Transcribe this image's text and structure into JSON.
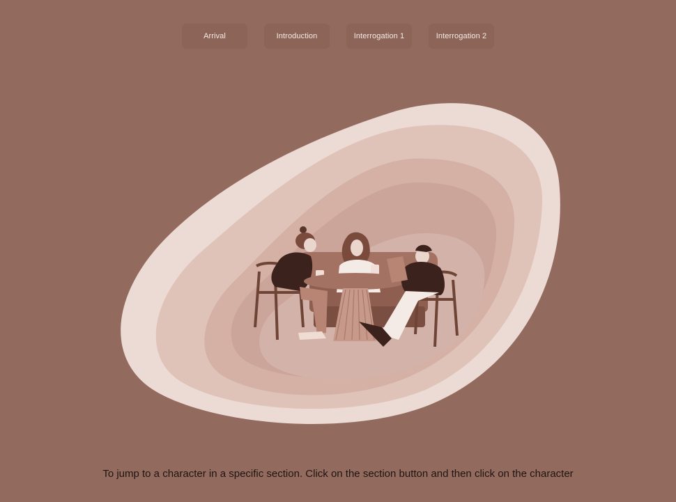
{
  "nav": {
    "buttons": [
      {
        "label": "Arrival"
      },
      {
        "label": "Introduction"
      },
      {
        "label": "Interrogation 1"
      },
      {
        "label": "Interrogation 2"
      }
    ]
  },
  "scene": {
    "characters": [
      "character-left",
      "character-center",
      "character-right"
    ]
  },
  "footer": {
    "hint": "To jump to a character in a specific section. Click on the section button and then click on the character"
  },
  "colors": {
    "background": "#936b5e",
    "button": "#8d6558",
    "ring_outer": "#ecdbd4",
    "ring_2": "#dfc2b8",
    "ring_3": "#d4b0a5",
    "ring_4": "#cba49a",
    "ring_inner": "#d3b3a9",
    "dark_figure": "#3b221c"
  }
}
